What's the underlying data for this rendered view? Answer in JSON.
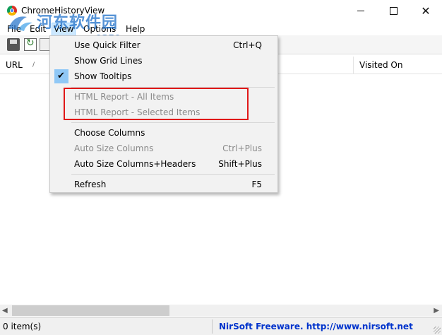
{
  "window": {
    "title": "ChromeHistoryView",
    "minimize_icon": "minimize-icon",
    "maximize_icon": "maximize-icon",
    "close_icon": "close-icon"
  },
  "menubar": {
    "items": [
      {
        "label": "File"
      },
      {
        "label": "Edit"
      },
      {
        "label": "View"
      },
      {
        "label": "Options"
      },
      {
        "label": "Help"
      }
    ],
    "active_index": 2
  },
  "watermark": {
    "text": "河东软件园",
    "url": "www.pc0359.cn"
  },
  "list": {
    "columns": [
      {
        "label": "URL"
      },
      {
        "label": "Visited On"
      }
    ],
    "sort_indicator": "/"
  },
  "view_menu": {
    "items": [
      {
        "label": "Use Quick Filter",
        "shortcut": "Ctrl+Q",
        "enabled": true
      },
      {
        "label": "Show Grid Lines",
        "shortcut": "",
        "enabled": true
      },
      {
        "label": "Show Tooltips",
        "shortcut": "",
        "enabled": true,
        "checked": true
      },
      {
        "label": "HTML Report - All Items",
        "shortcut": "",
        "enabled": false
      },
      {
        "label": "HTML Report - Selected Items",
        "shortcut": "",
        "enabled": false
      },
      {
        "label": "Choose Columns",
        "shortcut": "",
        "enabled": true
      },
      {
        "label": "Auto Size Columns",
        "shortcut": "Ctrl+Plus",
        "enabled": false
      },
      {
        "label": "Auto Size Columns+Headers",
        "shortcut": "Shift+Plus",
        "enabled": true
      },
      {
        "label": "Refresh",
        "shortcut": "F5",
        "enabled": true
      }
    ],
    "highlight_color": "#e01818"
  },
  "status": {
    "count": "0 item(s)",
    "link": "NirSoft Freeware.  http://www.nirsoft.net"
  },
  "colors": {
    "menu_active_bg": "#cce8ff",
    "link_blue": "#0033cc"
  }
}
